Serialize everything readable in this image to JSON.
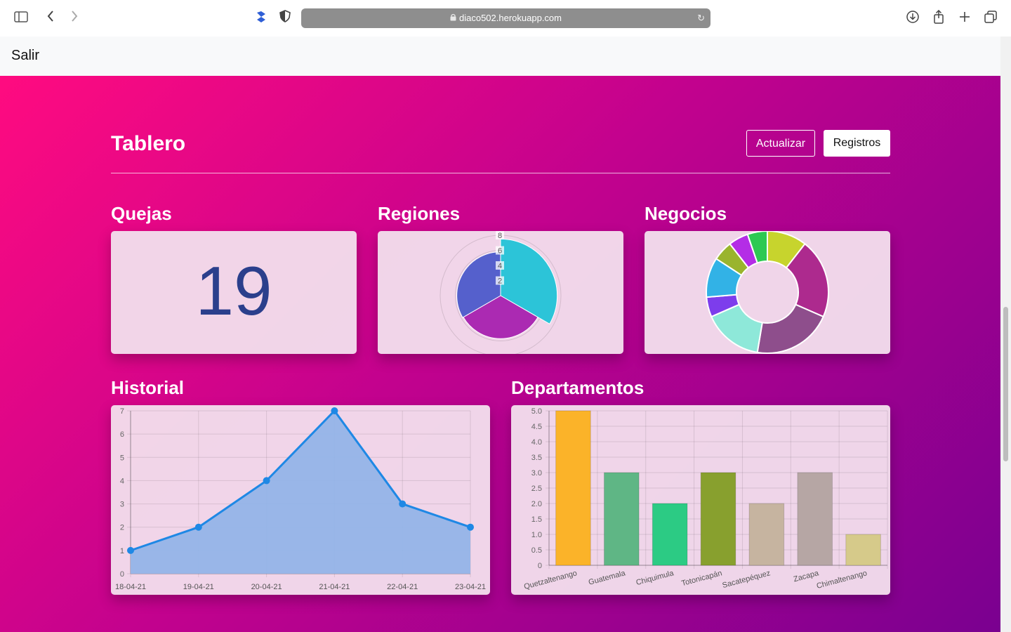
{
  "browser": {
    "url": "diaco502.herokuapp.com",
    "icons": [
      "sidebar-icon",
      "back-icon",
      "forward-icon",
      "extension-icon",
      "shield-icon",
      "lock-icon",
      "reload-icon",
      "download-icon",
      "share-icon",
      "new-tab-icon",
      "tabs-icon"
    ]
  },
  "nav": {
    "brand": "Salir"
  },
  "header": {
    "title": "Tablero",
    "btn_update": "Actualizar",
    "btn_records": "Registros"
  },
  "sections": {
    "quejas": "Quejas",
    "regiones": "Regiones",
    "negocios": "Negocios",
    "historial": "Historial",
    "departamentos": "Departamentos"
  },
  "quejas_count": "19",
  "chart_data": [
    {
      "type": "polar-area",
      "name": "Regiones",
      "ticks": [
        2,
        4,
        6,
        8
      ],
      "values": [
        7.5,
        5.7,
        5.8
      ],
      "colors": [
        "#2cc4d8",
        "#ab2ab2",
        "#5560cc"
      ]
    },
    {
      "type": "doughnut",
      "name": "Negocios",
      "values": [
        2,
        4,
        4,
        3,
        1,
        2,
        1,
        1,
        1
      ],
      "colors": [
        "#c7d42d",
        "#ad2a8e",
        "#8e4e8c",
        "#8ee8d9",
        "#7d3dec",
        "#32b2e6",
        "#9ab42d",
        "#b42de6",
        "#2dc952"
      ]
    },
    {
      "type": "area",
      "name": "Historial",
      "x": [
        "18-04-21",
        "19-04-21",
        "20-04-21",
        "21-04-21",
        "22-04-21",
        "23-04-21"
      ],
      "y": [
        1,
        2,
        4,
        7,
        3,
        2
      ],
      "ylim": [
        0,
        7
      ],
      "yticks": [
        0,
        1,
        2,
        3,
        4,
        5,
        6,
        7
      ],
      "color": "#1e88e5",
      "fill": "#93b4e8"
    },
    {
      "type": "bar",
      "name": "Departamentos",
      "categories": [
        "Quetzaltenango",
        "Guatemala",
        "Chiquimula",
        "Totonicapán",
        "Sacatepéquez",
        "Zacapa",
        "Chimaltenango"
      ],
      "values": [
        5,
        3,
        2,
        3,
        2,
        3,
        1
      ],
      "ylim": [
        0,
        5
      ],
      "yticks": [
        "0",
        "0.5",
        "1.0",
        "1.5",
        "2.0",
        "2.5",
        "3.0",
        "3.5",
        "4.0",
        "4.5",
        "5.0"
      ],
      "colors": [
        "#fbb329",
        "#5fb685",
        "#2ccb84",
        "#88a02e",
        "#c6b4a0",
        "#b6a6a4",
        "#d6ca8a"
      ]
    }
  ]
}
